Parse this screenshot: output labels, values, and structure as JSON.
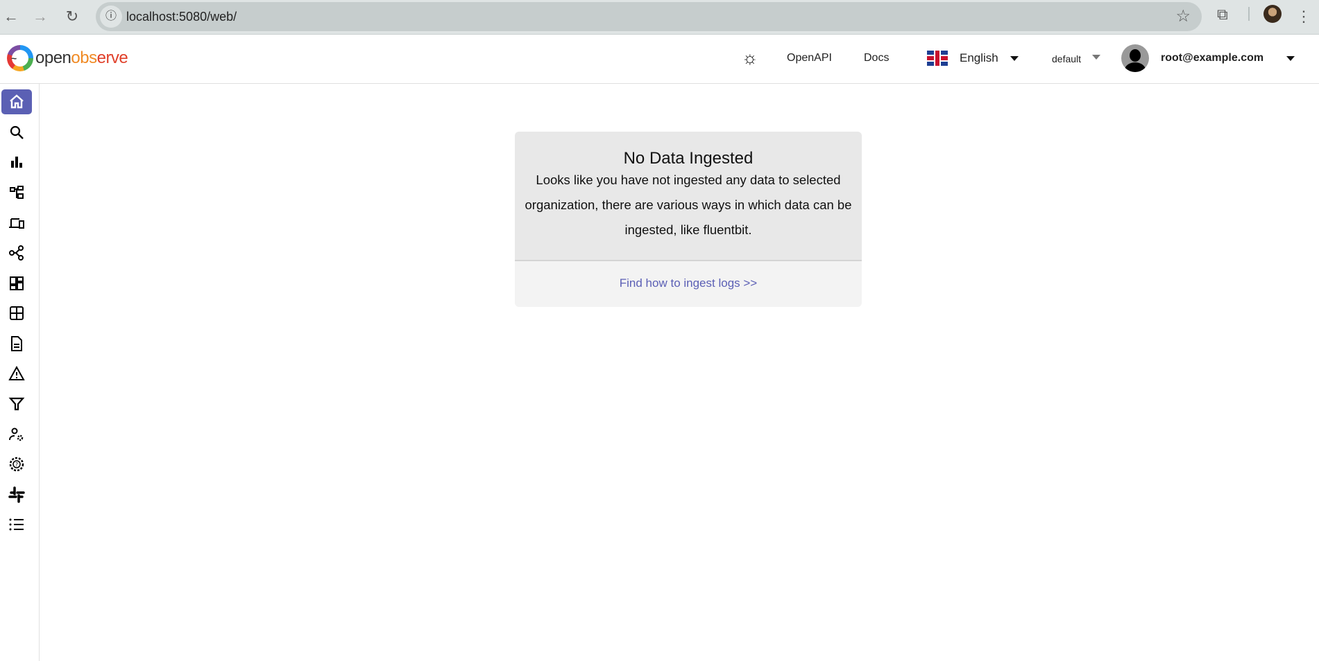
{
  "browser": {
    "url": "localhost:5080/web/",
    "back": "←",
    "forward": "→",
    "reload": "↻",
    "info": "ⓘ",
    "star": "☆",
    "extension": "⧉",
    "menu": "⋮"
  },
  "header": {
    "logo": {
      "part1": "open",
      "part2": "obs",
      "part3": "erve"
    },
    "theme_icon": "☼",
    "openapi": "OpenAPI",
    "docs": "Docs",
    "language": "English",
    "organization": "default",
    "user": "root@example.com"
  },
  "sidebar": {
    "items": [
      {
        "name": "home",
        "active": true
      },
      {
        "name": "search"
      },
      {
        "name": "metrics"
      },
      {
        "name": "traces"
      },
      {
        "name": "rum"
      },
      {
        "name": "pipelines"
      },
      {
        "name": "dashboards"
      },
      {
        "name": "streams"
      },
      {
        "name": "reports"
      },
      {
        "name": "alerts"
      },
      {
        "name": "data-sources"
      },
      {
        "name": "iam"
      },
      {
        "name": "help"
      },
      {
        "name": "slack"
      },
      {
        "name": "about"
      }
    ]
  },
  "main": {
    "title": "No Data Ingested",
    "message": "Looks like you have not ingested any data to selected organization, there are various ways in which data can be ingested, like fluentbit.",
    "link": "Find how to ingest logs >>"
  },
  "colors": {
    "accent": "#5b60b4",
    "link": "#5b5fb5",
    "card_top": "#e8e8e8",
    "card_bottom": "#f3f3f3"
  }
}
